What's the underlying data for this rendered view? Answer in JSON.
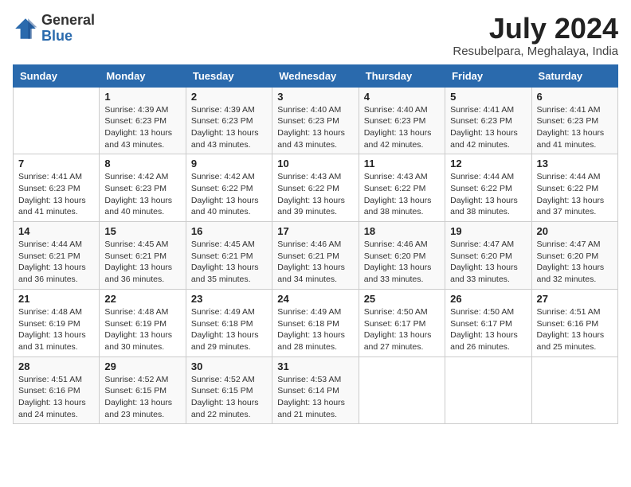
{
  "header": {
    "logo_general": "General",
    "logo_blue": "Blue",
    "month_year": "July 2024",
    "location": "Resubelpara, Meghalaya, India"
  },
  "weekdays": [
    "Sunday",
    "Monday",
    "Tuesday",
    "Wednesday",
    "Thursday",
    "Friday",
    "Saturday"
  ],
  "weeks": [
    [
      {
        "day": "",
        "info": ""
      },
      {
        "day": "1",
        "info": "Sunrise: 4:39 AM\nSunset: 6:23 PM\nDaylight: 13 hours\nand 43 minutes."
      },
      {
        "day": "2",
        "info": "Sunrise: 4:39 AM\nSunset: 6:23 PM\nDaylight: 13 hours\nand 43 minutes."
      },
      {
        "day": "3",
        "info": "Sunrise: 4:40 AM\nSunset: 6:23 PM\nDaylight: 13 hours\nand 43 minutes."
      },
      {
        "day": "4",
        "info": "Sunrise: 4:40 AM\nSunset: 6:23 PM\nDaylight: 13 hours\nand 42 minutes."
      },
      {
        "day": "5",
        "info": "Sunrise: 4:41 AM\nSunset: 6:23 PM\nDaylight: 13 hours\nand 42 minutes."
      },
      {
        "day": "6",
        "info": "Sunrise: 4:41 AM\nSunset: 6:23 PM\nDaylight: 13 hours\nand 41 minutes."
      }
    ],
    [
      {
        "day": "7",
        "info": "Sunrise: 4:41 AM\nSunset: 6:23 PM\nDaylight: 13 hours\nand 41 minutes."
      },
      {
        "day": "8",
        "info": "Sunrise: 4:42 AM\nSunset: 6:23 PM\nDaylight: 13 hours\nand 40 minutes."
      },
      {
        "day": "9",
        "info": "Sunrise: 4:42 AM\nSunset: 6:22 PM\nDaylight: 13 hours\nand 40 minutes."
      },
      {
        "day": "10",
        "info": "Sunrise: 4:43 AM\nSunset: 6:22 PM\nDaylight: 13 hours\nand 39 minutes."
      },
      {
        "day": "11",
        "info": "Sunrise: 4:43 AM\nSunset: 6:22 PM\nDaylight: 13 hours\nand 38 minutes."
      },
      {
        "day": "12",
        "info": "Sunrise: 4:44 AM\nSunset: 6:22 PM\nDaylight: 13 hours\nand 38 minutes."
      },
      {
        "day": "13",
        "info": "Sunrise: 4:44 AM\nSunset: 6:22 PM\nDaylight: 13 hours\nand 37 minutes."
      }
    ],
    [
      {
        "day": "14",
        "info": "Sunrise: 4:44 AM\nSunset: 6:21 PM\nDaylight: 13 hours\nand 36 minutes."
      },
      {
        "day": "15",
        "info": "Sunrise: 4:45 AM\nSunset: 6:21 PM\nDaylight: 13 hours\nand 36 minutes."
      },
      {
        "day": "16",
        "info": "Sunrise: 4:45 AM\nSunset: 6:21 PM\nDaylight: 13 hours\nand 35 minutes."
      },
      {
        "day": "17",
        "info": "Sunrise: 4:46 AM\nSunset: 6:21 PM\nDaylight: 13 hours\nand 34 minutes."
      },
      {
        "day": "18",
        "info": "Sunrise: 4:46 AM\nSunset: 6:20 PM\nDaylight: 13 hours\nand 33 minutes."
      },
      {
        "day": "19",
        "info": "Sunrise: 4:47 AM\nSunset: 6:20 PM\nDaylight: 13 hours\nand 33 minutes."
      },
      {
        "day": "20",
        "info": "Sunrise: 4:47 AM\nSunset: 6:20 PM\nDaylight: 13 hours\nand 32 minutes."
      }
    ],
    [
      {
        "day": "21",
        "info": "Sunrise: 4:48 AM\nSunset: 6:19 PM\nDaylight: 13 hours\nand 31 minutes."
      },
      {
        "day": "22",
        "info": "Sunrise: 4:48 AM\nSunset: 6:19 PM\nDaylight: 13 hours\nand 30 minutes."
      },
      {
        "day": "23",
        "info": "Sunrise: 4:49 AM\nSunset: 6:18 PM\nDaylight: 13 hours\nand 29 minutes."
      },
      {
        "day": "24",
        "info": "Sunrise: 4:49 AM\nSunset: 6:18 PM\nDaylight: 13 hours\nand 28 minutes."
      },
      {
        "day": "25",
        "info": "Sunrise: 4:50 AM\nSunset: 6:17 PM\nDaylight: 13 hours\nand 27 minutes."
      },
      {
        "day": "26",
        "info": "Sunrise: 4:50 AM\nSunset: 6:17 PM\nDaylight: 13 hours\nand 26 minutes."
      },
      {
        "day": "27",
        "info": "Sunrise: 4:51 AM\nSunset: 6:16 PM\nDaylight: 13 hours\nand 25 minutes."
      }
    ],
    [
      {
        "day": "28",
        "info": "Sunrise: 4:51 AM\nSunset: 6:16 PM\nDaylight: 13 hours\nand 24 minutes."
      },
      {
        "day": "29",
        "info": "Sunrise: 4:52 AM\nSunset: 6:15 PM\nDaylight: 13 hours\nand 23 minutes."
      },
      {
        "day": "30",
        "info": "Sunrise: 4:52 AM\nSunset: 6:15 PM\nDaylight: 13 hours\nand 22 minutes."
      },
      {
        "day": "31",
        "info": "Sunrise: 4:53 AM\nSunset: 6:14 PM\nDaylight: 13 hours\nand 21 minutes."
      },
      {
        "day": "",
        "info": ""
      },
      {
        "day": "",
        "info": ""
      },
      {
        "day": "",
        "info": ""
      }
    ]
  ]
}
